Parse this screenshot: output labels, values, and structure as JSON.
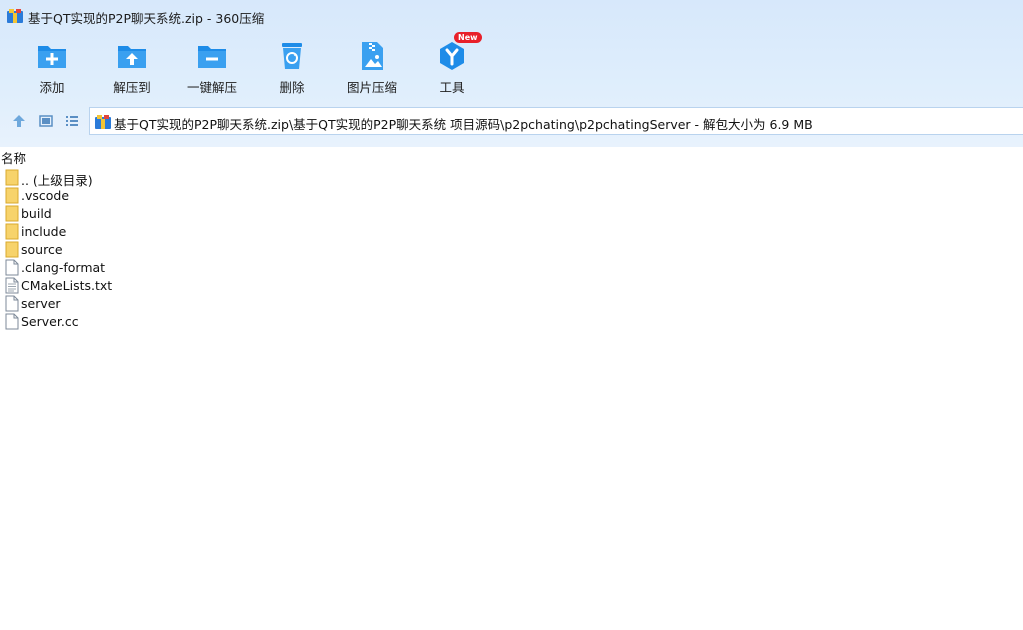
{
  "window": {
    "title": "基于QT实现的P2P聊天系统.zip - 360压缩"
  },
  "toolbar": {
    "items": [
      {
        "label": "添加",
        "icon": "add-icon"
      },
      {
        "label": "解压到",
        "icon": "extract-to-icon"
      },
      {
        "label": "一键解压",
        "icon": "one-click-extract-icon"
      },
      {
        "label": "删除",
        "icon": "delete-icon"
      },
      {
        "label": "图片压缩",
        "icon": "image-compress-icon"
      },
      {
        "label": "工具",
        "icon": "tools-icon",
        "badge": "New"
      }
    ]
  },
  "nav": {
    "path": "基于QT实现的P2P聊天系统.zip\\基于QT实现的P2P聊天系统 项目源码\\p2pchating\\p2pchatingServer - 解包大小为 6.9 MB"
  },
  "list": {
    "column_name": "名称",
    "rows": [
      {
        "name": ".. (上级目录)",
        "type": "folder"
      },
      {
        "name": ".vscode",
        "type": "folder"
      },
      {
        "name": "build",
        "type": "folder"
      },
      {
        "name": "include",
        "type": "folder"
      },
      {
        "name": "source",
        "type": "folder"
      },
      {
        "name": ".clang-format",
        "type": "file"
      },
      {
        "name": "CMakeLists.txt",
        "type": "text-file"
      },
      {
        "name": "server",
        "type": "file"
      },
      {
        "name": "Server.cc",
        "type": "file"
      }
    ]
  },
  "colors": {
    "accent": "#1e8ce8",
    "header_bg": "#dcebfc",
    "badge": "#e8202a",
    "folder": "#f7d36b"
  }
}
